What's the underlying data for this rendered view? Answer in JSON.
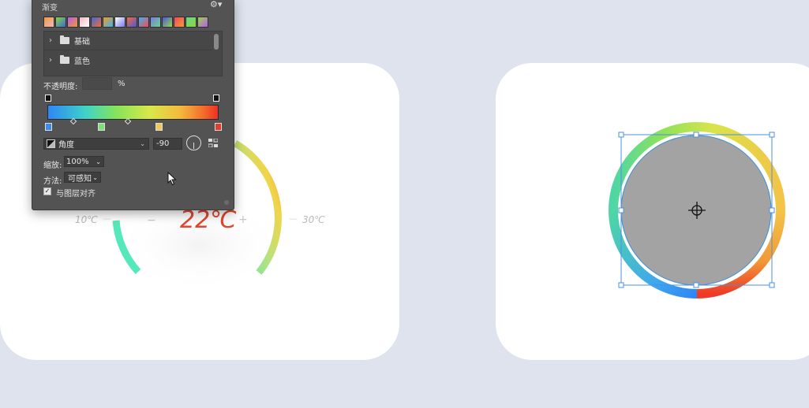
{
  "left_card": {
    "temperature": "22℃",
    "min_label": "10℃",
    "max_label": "30℃",
    "minus": "−",
    "plus": "+",
    "tick": "—"
  },
  "gradient_panel": {
    "title": "渐变",
    "gear_icon": "⚙▾",
    "swatches": [
      "#f29a3a",
      "#8bd641",
      "#b85cf0",
      "#f0b8c2",
      "#3a6bd6",
      "#f09a2a",
      "#ffffff",
      "#f26b3a",
      "#3fb4e8",
      "#7a7ae8",
      "#4a58d8",
      "#f24a5a",
      "#6ad68a",
      "#9ad64a"
    ],
    "folders": [
      {
        "label": "基础",
        "chevron": "›"
      },
      {
        "label": "蓝色",
        "chevron": "›"
      }
    ],
    "opacity_label": "不透明度:",
    "opacity_value": "",
    "opacity_unit": "%",
    "style_value": "角度",
    "angle_value": "-90",
    "scale_label": "缩放:",
    "scale_value": "100%",
    "method_label": "方法:",
    "method_value": "可感知",
    "align_label": "与图层对齐",
    "align_checked": "✓",
    "caret": "⌄",
    "color_stops": [
      {
        "color": "#3b8cf0",
        "pos": 0.0
      },
      {
        "color": "#7fe07a",
        "pos": 0.31
      },
      {
        "color": "#f1c95a",
        "pos": 0.65
      },
      {
        "color": "#e8392a",
        "pos": 1.0
      }
    ],
    "midpoints": [
      0.15,
      0.47
    ]
  },
  "colors": {
    "background": "#dee3ee",
    "accent_red": "#e0472b"
  }
}
